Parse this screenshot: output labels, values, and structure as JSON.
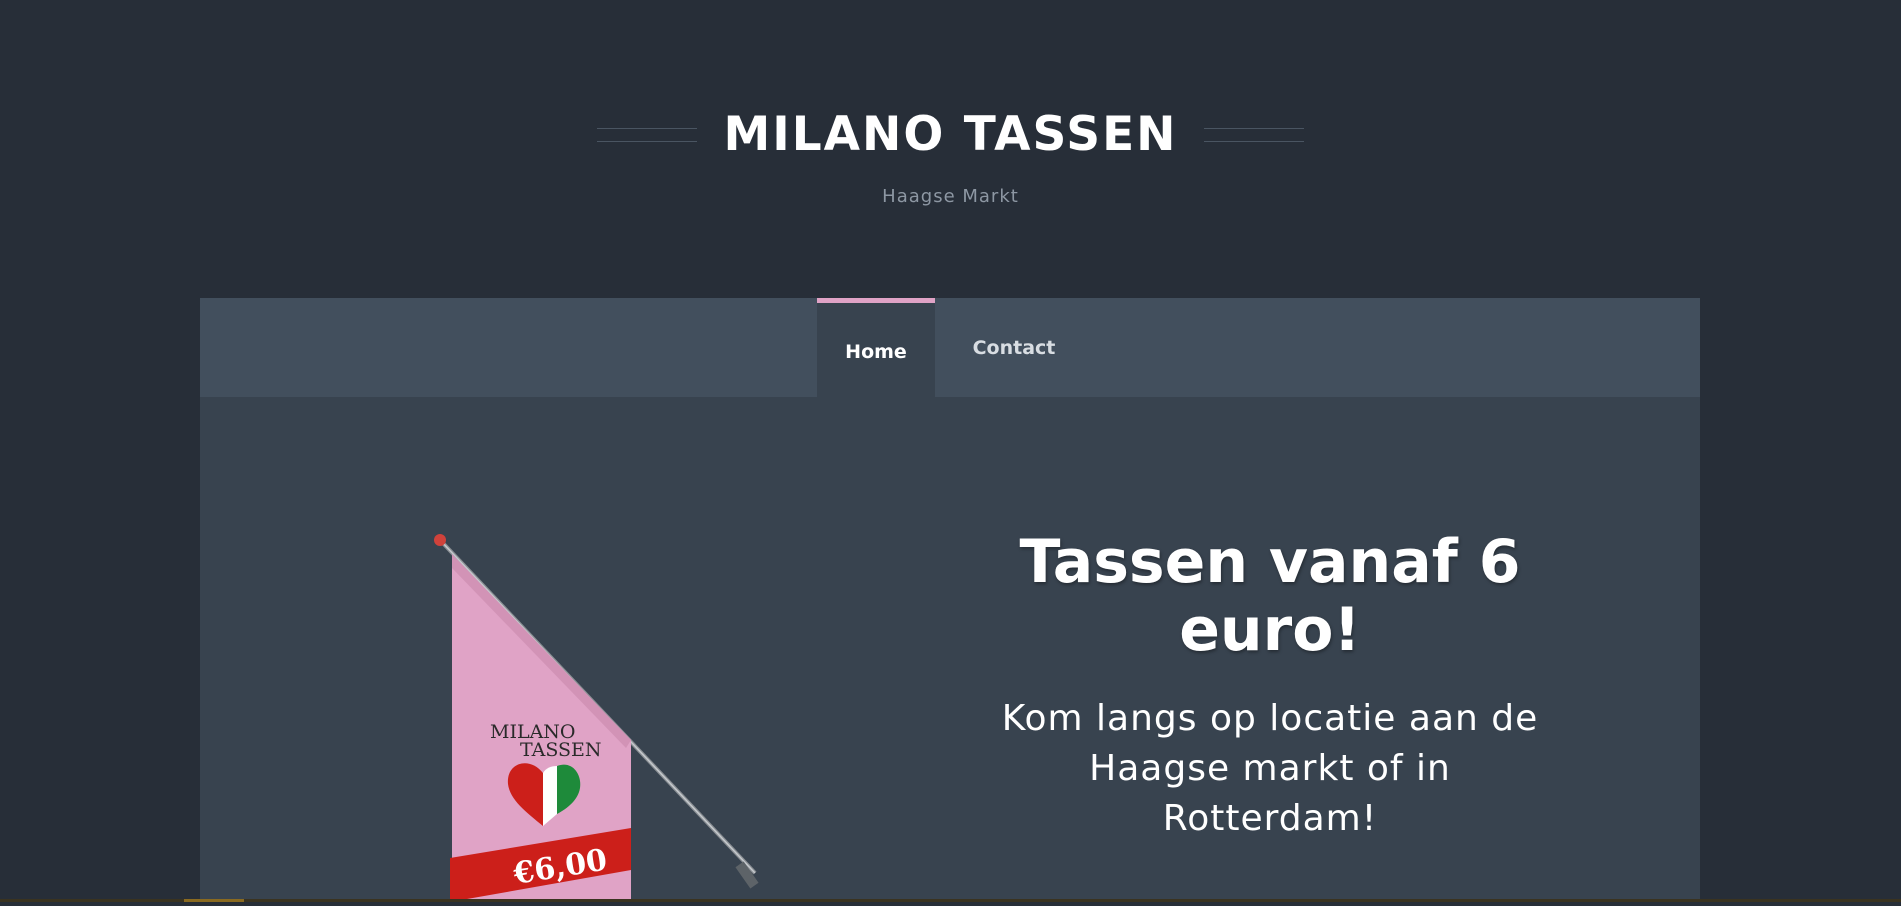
{
  "header": {
    "title": "MILANO TASSEN",
    "tagline": "Haagse Markt"
  },
  "nav": {
    "items": [
      {
        "label": "Home",
        "active": true
      },
      {
        "label": "Contact",
        "active": false
      }
    ]
  },
  "hero": {
    "title": "Tassen vanaf 6 euro!",
    "subtitle": "Kom langs op locatie aan de Haagse markt of in Rotterdam!"
  },
  "flag": {
    "brand_line1": "MILANO",
    "brand_line2": "TASSEN",
    "price": "€6,00",
    "flag_color": "#e0a3c6",
    "banner_color": "#cc1f1a"
  },
  "colors": {
    "background": "#272e38",
    "panel": "#38434f",
    "nav": "#424f5d",
    "accent": "#e0a3c6"
  }
}
